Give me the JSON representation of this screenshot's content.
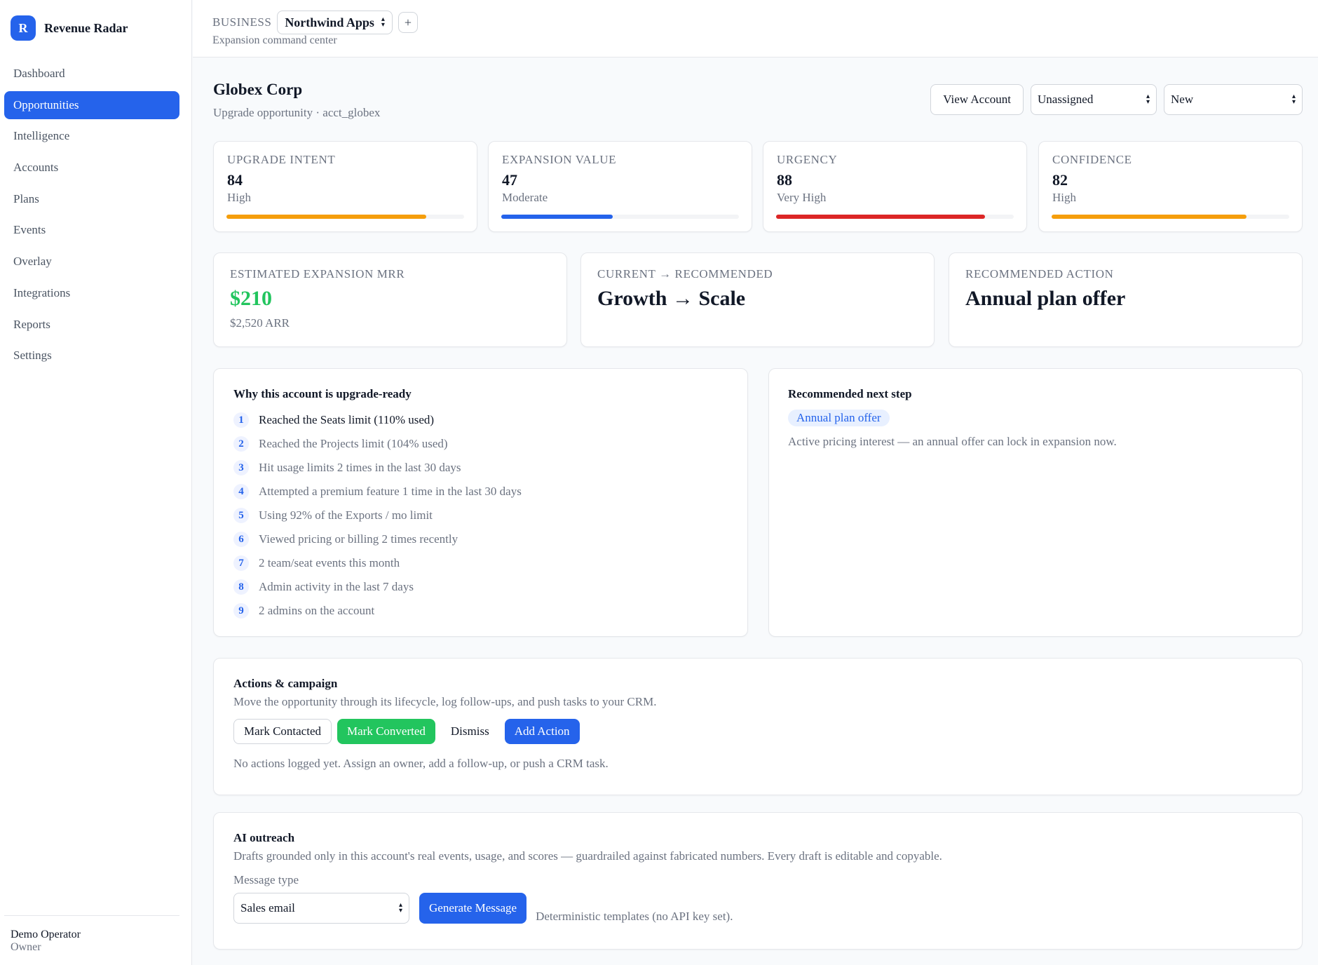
{
  "brand": {
    "logo_letter": "R",
    "name": "Revenue Radar"
  },
  "nav": [
    {
      "label": "Dashboard"
    },
    {
      "label": "Opportunities"
    },
    {
      "label": "Intelligence"
    },
    {
      "label": "Accounts"
    },
    {
      "label": "Plans"
    },
    {
      "label": "Events"
    },
    {
      "label": "Overlay"
    },
    {
      "label": "Integrations"
    },
    {
      "label": "Reports"
    },
    {
      "label": "Settings"
    }
  ],
  "nav_active": "Opportunities",
  "user": {
    "name": "Demo Operator",
    "role": "Owner"
  },
  "topbar": {
    "business_label": "BUSINESS",
    "business_value": "Northwind Apps",
    "add_label": "+",
    "subtitle": "Expansion command center"
  },
  "account": {
    "name": "Globex Corp",
    "subtitle": "Upgrade opportunity · acct_globex",
    "view_button": "View Account",
    "owner_select": "Unassigned",
    "status_select": "New"
  },
  "metrics": [
    {
      "label": "UPGRADE INTENT",
      "value": "84",
      "level": "High",
      "fill": 0.84,
      "color": "#f59e0b"
    },
    {
      "label": "EXPANSION VALUE",
      "value": "47",
      "level": "Moderate",
      "fill": 0.47,
      "color": "#2563eb"
    },
    {
      "label": "URGENCY",
      "value": "88",
      "level": "Very High",
      "fill": 0.88,
      "color": "#dc2626"
    },
    {
      "label": "CONFIDENCE",
      "value": "82",
      "level": "High",
      "fill": 0.82,
      "color": "#f59e0b"
    }
  ],
  "summary": {
    "mrr_label": "ESTIMATED EXPANSION MRR",
    "mrr_value": "$210",
    "mrr_sub": "$2,520 ARR",
    "mrr_color": "#22c55e",
    "plan_label": "CURRENT → RECOMMENDED",
    "plan_value": "Growth → Scale",
    "action_label": "RECOMMENDED ACTION",
    "action_value": "Annual plan offer"
  },
  "reasons": {
    "title": "Why this account is upgrade-ready",
    "items": [
      {
        "n": "1",
        "text": "Reached the Seats limit (110% used)"
      },
      {
        "n": "2",
        "text": "Reached the Projects limit (104% used)"
      },
      {
        "n": "3",
        "text": "Hit usage limits 2 times in the last 30 days"
      },
      {
        "n": "4",
        "text": "Attempted a premium feature 1 time in the last 30 days"
      },
      {
        "n": "5",
        "text": "Using 92% of the Exports / mo limit"
      },
      {
        "n": "6",
        "text": "Viewed pricing or billing 2 times recently"
      },
      {
        "n": "7",
        "text": "2 team/seat events this month"
      },
      {
        "n": "8",
        "text": "Admin activity in the last 7 days"
      },
      {
        "n": "9",
        "text": "2 admins on the account"
      }
    ]
  },
  "next_step": {
    "title": "Recommended next step",
    "pill": "Annual plan offer",
    "text": "Active pricing interest — an annual offer can lock in expansion now."
  },
  "actions": {
    "title": "Actions & campaign",
    "subtitle": "Move the opportunity through its lifecycle, log follow-ups, and push tasks to your CRM.",
    "mark_contacted": "Mark Contacted",
    "mark_converted": "Mark Converted",
    "dismiss": "Dismiss",
    "add_action": "Add Action",
    "empty": "No actions logged yet. Assign an owner, add a follow-up, or push a CRM task."
  },
  "outreach": {
    "title": "AI outreach",
    "subtitle": "Drafts grounded only in this account's real events, usage, and scores — guardrailed against fabricated numbers. Every draft is editable and copyable.",
    "message_type_label": "Message type",
    "message_type_value": "Sales email",
    "generate": "Generate Message",
    "note": "Deterministic templates (no API key set)."
  }
}
